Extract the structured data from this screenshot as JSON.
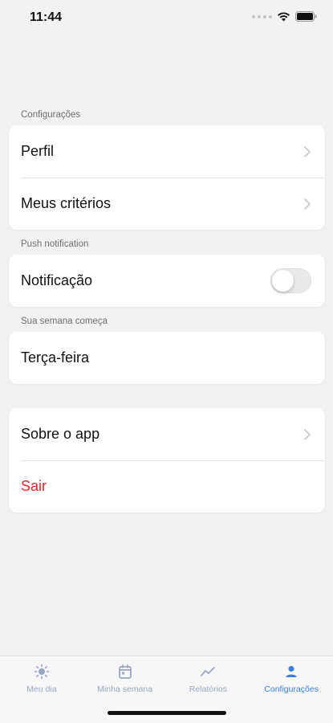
{
  "status_bar": {
    "time": "11:44"
  },
  "sections": {
    "configuracoes": {
      "header": "Configurações",
      "items": [
        {
          "label": "Perfil"
        },
        {
          "label": "Meus critérios"
        }
      ]
    },
    "push": {
      "header": "Push notification",
      "item_label": "Notificação",
      "toggle_on": false
    },
    "semana": {
      "header": "Sua semana começa",
      "item_label": "Terça-feira"
    },
    "other": {
      "about_label": "Sobre o app",
      "logout_label": "Sair"
    }
  },
  "tab_bar": {
    "tabs": [
      {
        "label": "Meu dia",
        "icon": "sun-icon"
      },
      {
        "label": "Minha semana",
        "icon": "calendar-icon"
      },
      {
        "label": "Relatórios",
        "icon": "chart-line-icon"
      },
      {
        "label": "Configurações",
        "icon": "user-icon",
        "active": true
      }
    ]
  },
  "colors": {
    "accent": "#3b7ddd",
    "danger": "#e5232a",
    "background": "#f2f2f2"
  }
}
